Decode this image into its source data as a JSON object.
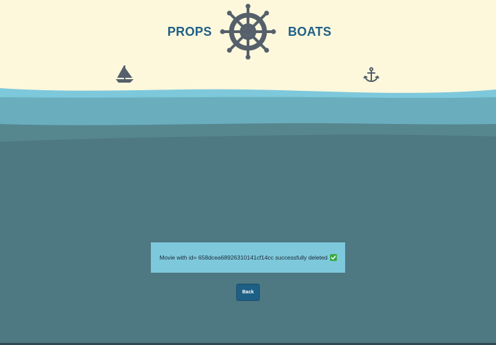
{
  "header": {
    "brand_left": "PROPS",
    "brand_right": "BOATS",
    "logo_icon": "ship-wheel-icon",
    "left_decoration_icon": "sailboat-icon",
    "right_decoration_icon": "anchor-icon"
  },
  "message": {
    "text": "Movie with id= 658dcea68926310141cf14cc successfully deleted",
    "status_icon": "check-mark-icon"
  },
  "actions": {
    "back_label": "Back"
  },
  "colors": {
    "sky": "#fdf8dc",
    "wave_light": "#7ec8dc",
    "wave_mid": "#6aaebe",
    "sea_deep": "#4e7882",
    "brand": "#1f5f86",
    "icon_gray": "#56606b",
    "message_bg": "#7ec8dc",
    "button_bg": "#1d5f85",
    "check_green": "#3aa843"
  }
}
